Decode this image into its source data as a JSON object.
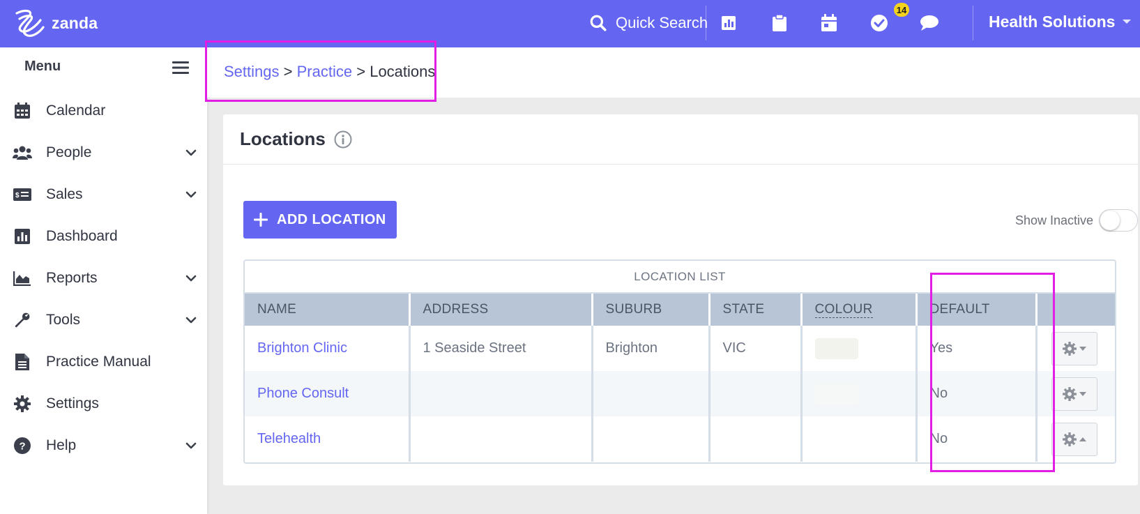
{
  "brand": {
    "name": "zanda",
    "color": "#6466f1",
    "logo_icon": "zanda-swirl-icon"
  },
  "topbar": {
    "quick_search_label": "Quick Search",
    "icons": [
      "search-icon",
      "chart-icon",
      "clipboard-icon",
      "calendar-icon",
      "check-circle-icon",
      "chat-icon"
    ],
    "tasks_badge": "14",
    "org_name": "Health Solutions"
  },
  "sidebar": {
    "menu_label": "Menu",
    "items": [
      {
        "label": "Calendar",
        "icon": "calendar-icon",
        "has_submenu": false
      },
      {
        "label": "People",
        "icon": "people-icon",
        "has_submenu": true
      },
      {
        "label": "Sales",
        "icon": "money-icon",
        "has_submenu": true
      },
      {
        "label": "Dashboard",
        "icon": "dashboard-icon",
        "has_submenu": false
      },
      {
        "label": "Reports",
        "icon": "area-chart-icon",
        "has_submenu": true
      },
      {
        "label": "Tools",
        "icon": "wrench-icon",
        "has_submenu": true
      },
      {
        "label": "Practice Manual",
        "icon": "document-icon",
        "has_submenu": false
      },
      {
        "label": "Settings",
        "icon": "gear-icon",
        "has_submenu": false
      },
      {
        "label": "Help",
        "icon": "question-icon",
        "has_submenu": true
      }
    ]
  },
  "breadcrumb": {
    "items": [
      "Settings",
      "Practice",
      "Locations"
    ],
    "separator": ">"
  },
  "page": {
    "title": "Locations",
    "add_button_label": "ADD LOCATION",
    "show_inactive_label": "Show Inactive",
    "show_inactive_on": false
  },
  "table": {
    "caption": "LOCATION LIST",
    "columns": [
      "NAME",
      "ADDRESS",
      "SUBURB",
      "STATE",
      "COLOUR",
      "DEFAULT",
      ""
    ],
    "rows": [
      {
        "name": "Brighton Clinic",
        "address": "1 Seaside Street",
        "suburb": "Brighton",
        "state": "VIC",
        "colour": "#f3f3ee",
        "default": "Yes"
      },
      {
        "name": "Phone Consult",
        "address": "",
        "suburb": "",
        "state": "",
        "colour": "#f6f7f7",
        "default": "No"
      },
      {
        "name": "Telehealth",
        "address": "",
        "suburb": "",
        "state": "",
        "colour": "",
        "default": "No"
      }
    ]
  },
  "highlight_color": "#e21de6"
}
